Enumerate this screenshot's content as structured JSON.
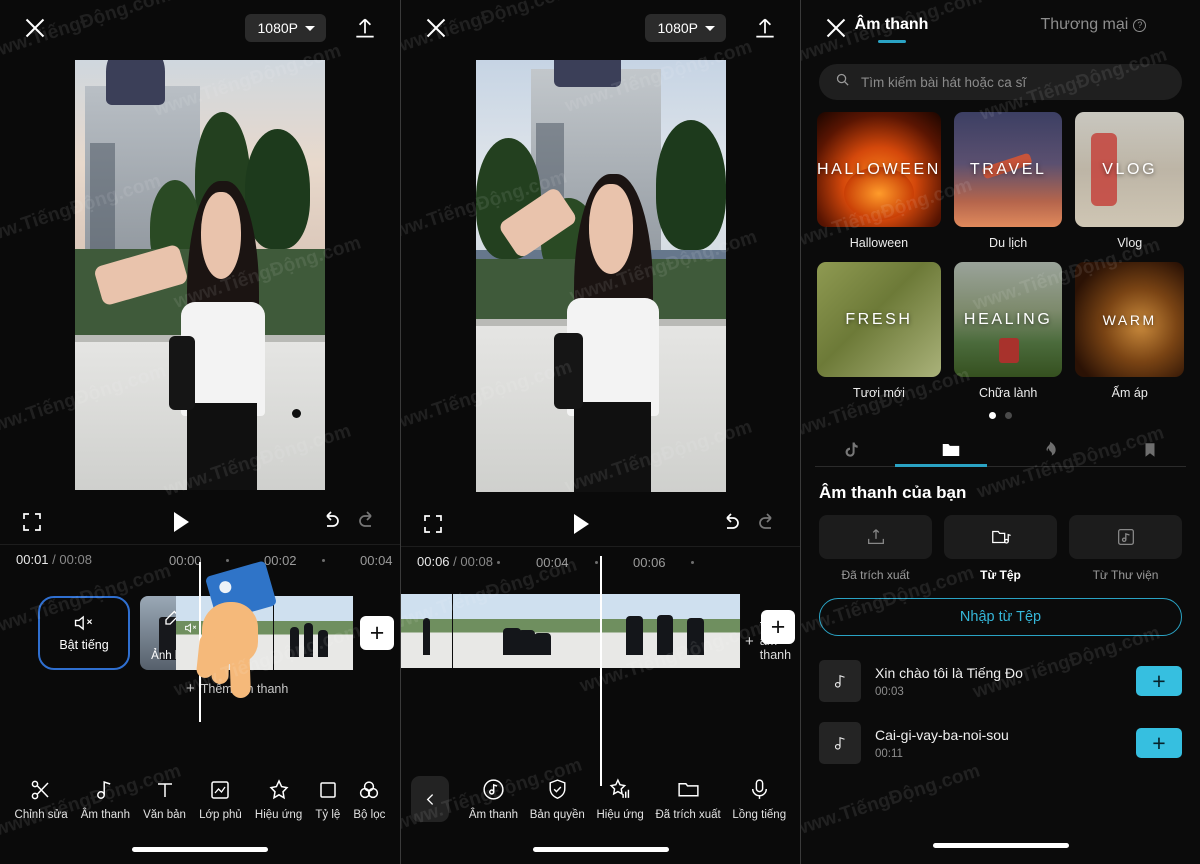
{
  "app": {
    "accent": "#2aa3c4",
    "add_accent": "#36bfe0",
    "highlight_border": "#2f6fd0"
  },
  "watermark": {
    "text_a": "www.TiếngĐộng.com",
    "text_b": "www.TiếngĐộng.com"
  },
  "panel1": {
    "topbar": {
      "close": "close-icon",
      "resolution": "1080P",
      "export": "export-icon"
    },
    "player": {
      "expand": "expand-icon",
      "play": "play-icon",
      "undo": "undo-icon",
      "redo": "redo-icon"
    },
    "timeline": {
      "current": "00:01",
      "separator": "/",
      "total": "00:08",
      "ticks": [
        "00:00",
        "00:02",
        "00:04"
      ]
    },
    "mute_button": {
      "label": "Bật tiếng"
    },
    "cover_button": {
      "label": "Ảnh bìa"
    },
    "add_audio": {
      "label": "Thêm âm thanh"
    },
    "add_clip": {
      "label": "+"
    },
    "tools": [
      {
        "label": "Chỉnh sửa",
        "icon": "scissors-icon"
      },
      {
        "label": "Âm thanh",
        "icon": "music-note-icon"
      },
      {
        "label": "Văn bản",
        "icon": "text-icon"
      },
      {
        "label": "Lớp phủ",
        "icon": "overlay-icon"
      },
      {
        "label": "Hiệu ứng",
        "icon": "sparkle-icon"
      },
      {
        "label": "Tỷ lệ",
        "icon": "ratio-icon"
      },
      {
        "label": "Bộ lọc",
        "icon": "filter-icon"
      }
    ]
  },
  "panel2": {
    "topbar": {
      "close": "close-icon",
      "resolution": "1080P",
      "export": "export-icon"
    },
    "player": {
      "expand": "expand-icon",
      "play": "play-icon",
      "undo": "undo-icon",
      "redo": "redo-icon"
    },
    "timeline": {
      "current": "00:06",
      "separator": "/",
      "total": "00:08",
      "ticks": [
        "00:04",
        "00:06"
      ]
    },
    "add_audio": {
      "label": "Thêm âm thanh"
    },
    "add_clip": {
      "label": "+"
    },
    "back": "chevron-left-icon",
    "tools": [
      {
        "label": "Âm thanh",
        "icon": "music-circle-icon"
      },
      {
        "label": "Bản quyền",
        "icon": "shield-check-icon"
      },
      {
        "label": "Hiệu ứng",
        "icon": "sparkle-eq-icon"
      },
      {
        "label": "Đã trích xuất",
        "icon": "folder-icon"
      },
      {
        "label": "Lồng tiếng",
        "icon": "microphone-icon"
      }
    ]
  },
  "panel3": {
    "close": "close-icon",
    "tabs": [
      {
        "label": "Âm thanh",
        "active": true
      },
      {
        "label": "Thương mại",
        "active": false,
        "help": "?"
      }
    ],
    "search": {
      "placeholder": "Tìm kiếm bài hát hoặc ca sĩ",
      "icon": "search-icon"
    },
    "categories": [
      {
        "art_text": "HALLOWEEN",
        "name": "Halloween",
        "bg": "bg-hw"
      },
      {
        "art_text": "TRAVEL",
        "name": "Du lịch",
        "bg": "bg-tv"
      },
      {
        "art_text": "VLOG",
        "name": "Vlog",
        "bg": "bg-vg"
      },
      {
        "art_text": "FRESH",
        "name": "Tươi mới",
        "bg": "bg-fr"
      },
      {
        "art_text": "HEALING",
        "name": "Chữa lành",
        "bg": "bg-hl"
      },
      {
        "art_text": "WARM",
        "name": "Ấm áp",
        "bg": "bg-wm"
      }
    ],
    "pager": {
      "pages": 2,
      "current": 1
    },
    "nav_icons": [
      {
        "icon": "tiktok-note-icon",
        "active": false
      },
      {
        "icon": "folder-icon",
        "active": true
      },
      {
        "icon": "flame-icon",
        "active": false
      },
      {
        "icon": "bookmark-icon",
        "active": false
      }
    ],
    "section_title": "Âm thanh của bạn",
    "sources": [
      {
        "label": "Đã trích xuất",
        "icon": "extract-icon",
        "selected": false
      },
      {
        "label": "Từ Tệp",
        "icon": "folder-music-icon",
        "selected": true
      },
      {
        "label": "Từ Thư viện",
        "icon": "library-music-icon",
        "selected": false
      }
    ],
    "import_button": {
      "label": "Nhập từ Tệp"
    },
    "songs": [
      {
        "name": "Xin chào tôi là Tiếng Đo",
        "duration": "00:03",
        "add": "+"
      },
      {
        "name": "Cai-gi-vay-ba-noi-sou",
        "duration": "00:11",
        "add": "+"
      }
    ]
  }
}
